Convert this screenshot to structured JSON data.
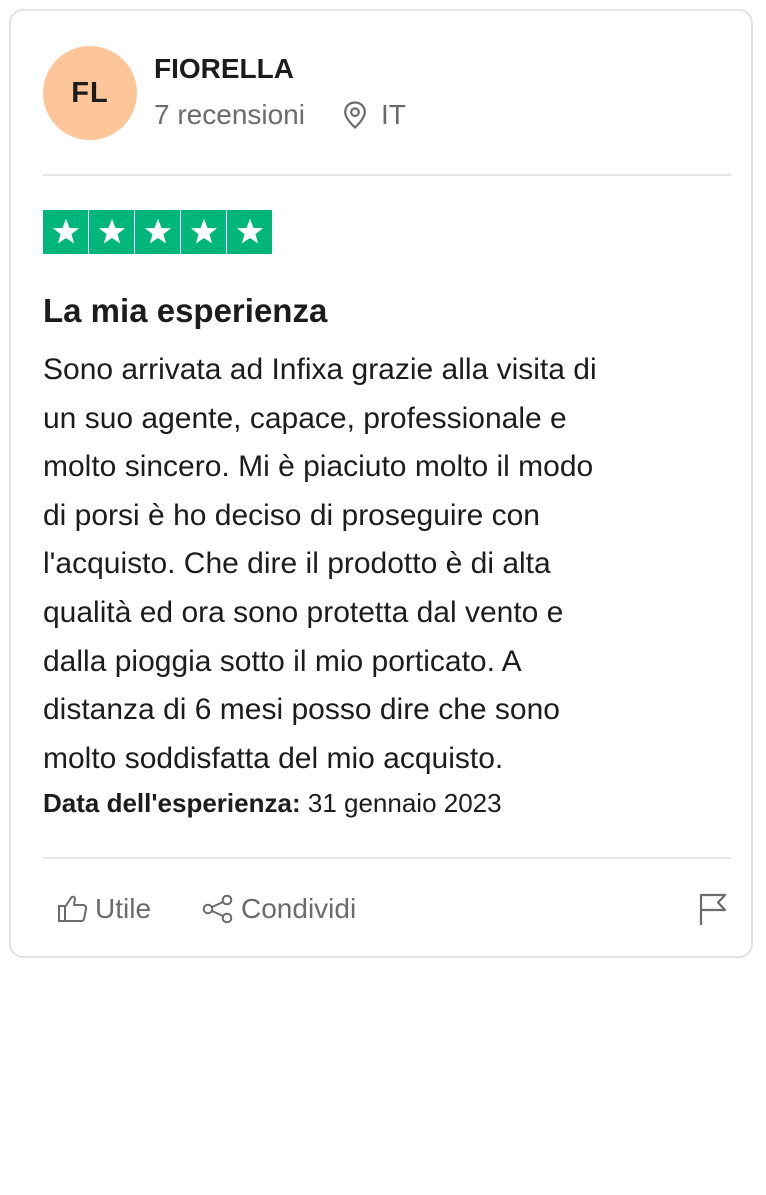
{
  "reviewer": {
    "initials": "FL",
    "name": "FIORELLA",
    "review_count": "7 recensioni",
    "country": "IT",
    "avatar_color": "#fcc699"
  },
  "rating": {
    "stars": 5,
    "max_stars": 5,
    "color": "#00b67a"
  },
  "review": {
    "title": "La mia esperienza",
    "lines": [
      "Sono arrivata ad Infixa grazie alla visita di",
      "un suo agente, capace, professionale e",
      "molto sincero. Mi è piaciuto molto il modo",
      "di porsi è ho deciso di proseguire con",
      "l'acquisto. Che dire il prodotto è di alta",
      "qualità ed ora sono protetta dal vento e",
      "dalla pioggia sotto il mio porticato. A",
      "distanza di 6 mesi posso dire che sono",
      "molto soddisfatta del mio acquisto."
    ],
    "date_label": "Data dell'esperienza:",
    "date_value": "31 gennaio 2023"
  },
  "actions": {
    "useful_label": "Utile",
    "share_label": "Condividi",
    "useful_icon": "thumbs-up-icon",
    "share_icon": "share-icon",
    "flag_icon": "flag-icon"
  }
}
